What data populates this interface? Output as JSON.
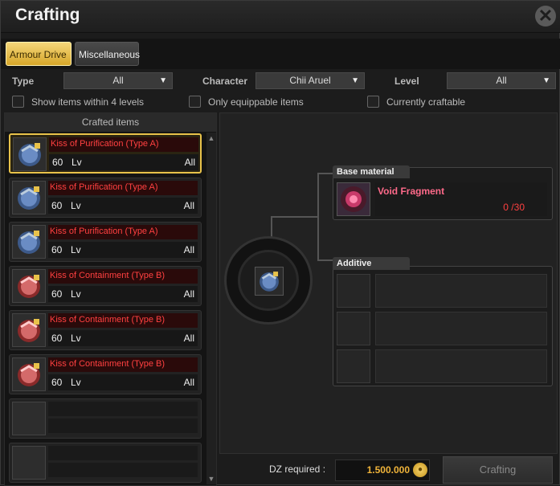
{
  "window": {
    "title": "Crafting",
    "close_label": "✕"
  },
  "tabs": [
    {
      "label": "Armour Drive",
      "active": true
    },
    {
      "label": "Miscellaneous",
      "active": false
    }
  ],
  "filters": {
    "type_label": "Type",
    "type_value": "All",
    "character_label": "Character",
    "character_value": "Chii Aruel",
    "level_label": "Level",
    "level_value": "All"
  },
  "checkboxes": [
    {
      "label": "Show items within 4 levels",
      "checked": false
    },
    {
      "label": "Only equippable items",
      "checked": false
    },
    {
      "label": "Currently craftable",
      "checked": false
    }
  ],
  "crafted_list": {
    "header": "Crafted items",
    "items": [
      {
        "name": "Kiss of Purification (Type A)",
        "level": "60",
        "level_label": "Lv",
        "class": "All",
        "icon": "blue-armour-icon",
        "selected": true
      },
      {
        "name": "Kiss of Purification (Type A)",
        "level": "60",
        "level_label": "Lv",
        "class": "All",
        "icon": "blue-armour-icon",
        "selected": false
      },
      {
        "name": "Kiss of Purification (Type A)",
        "level": "60",
        "level_label": "Lv",
        "class": "All",
        "icon": "blue-armour-icon",
        "selected": false
      },
      {
        "name": "Kiss of Containment (Type B)",
        "level": "60",
        "level_label": "Lv",
        "class": "All",
        "icon": "red-armour-icon",
        "selected": false
      },
      {
        "name": "Kiss of Containment (Type B)",
        "level": "60",
        "level_label": "Lv",
        "class": "All",
        "icon": "red-armour-icon",
        "selected": false
      },
      {
        "name": "Kiss of Containment (Type B)",
        "level": "60",
        "level_label": "Lv",
        "class": "All",
        "icon": "red-armour-icon",
        "selected": false
      }
    ]
  },
  "recipe": {
    "base_material_label": "Base material",
    "base_material_name": "Void Fragment",
    "base_material_quantity": "0 /30",
    "additive_label": "Additive"
  },
  "footer": {
    "dz_label": "DZ required :",
    "dz_value": "1.500.000",
    "craft_button": "Crafting"
  },
  "colors": {
    "accent_gold": "#e8c24a",
    "item_name_red": "#ff4040",
    "material_pink": "#ff6a8a",
    "dz_gold": "#f0b43a"
  }
}
